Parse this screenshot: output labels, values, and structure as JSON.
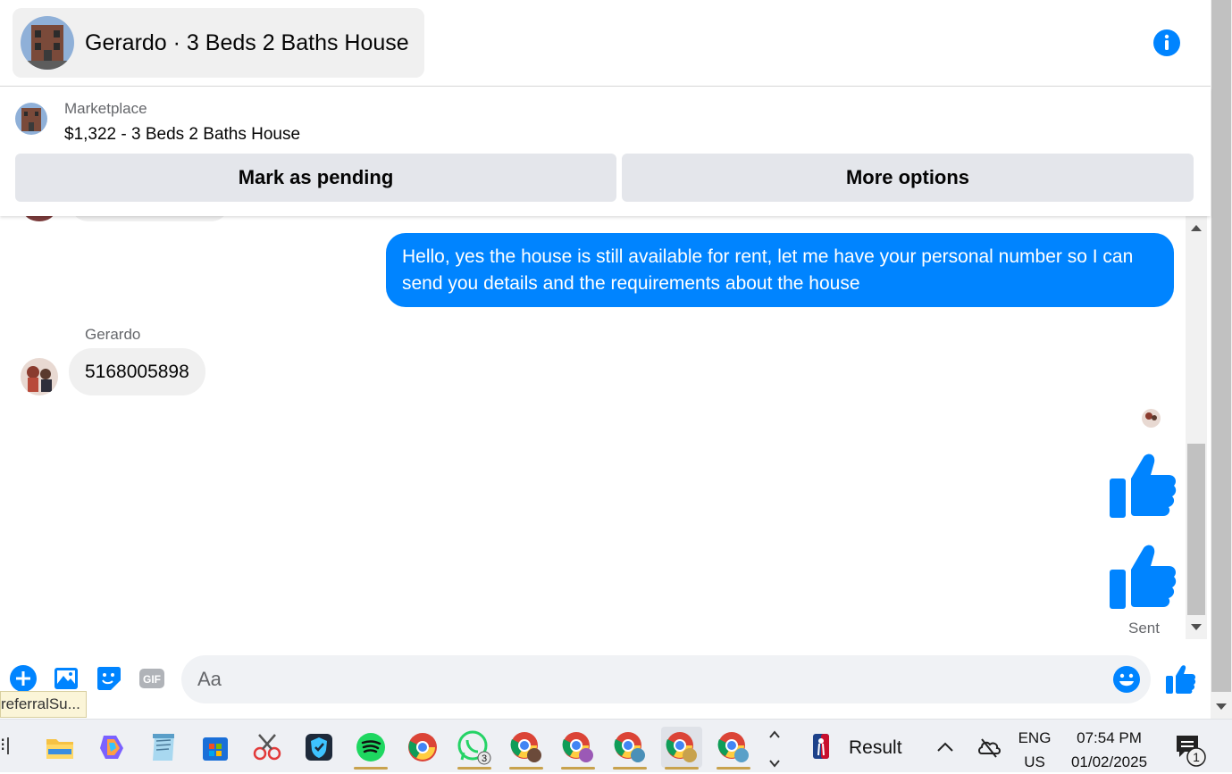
{
  "header": {
    "conversation_title": "Gerardo · 3 Beds 2 Baths House"
  },
  "marketplace": {
    "label": "Marketplace",
    "listing": "$1,322 - 3 Beds 2 Baths House",
    "mark_pending_label": "Mark as pending",
    "more_options_label": "More options"
  },
  "messages": {
    "outgoing_text": "Hello, yes the house is still available for rent, let me have your personal number so I can send you details and the requirements about the house",
    "sender_name": "Gerardo",
    "incoming_text": "5168005898",
    "status": "Sent"
  },
  "composer": {
    "placeholder": "Aa",
    "tooltip": "referralSu..."
  },
  "taskbar": {
    "edge_glyph": "⁝|",
    "whatsapp_badge": "3",
    "widget_text": "Result",
    "lang_line1": "ENG",
    "lang_line2": "US",
    "time": "07:54 PM",
    "date": "01/02/2025",
    "notification_count": "1"
  },
  "colors": {
    "messenger_blue": "#0084ff",
    "bubble_gray": "#f0f0f0",
    "button_gray": "#e4e6eb"
  }
}
